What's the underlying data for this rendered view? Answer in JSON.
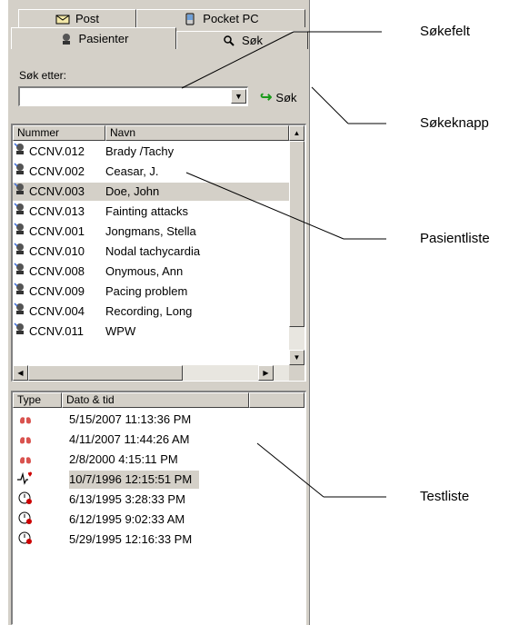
{
  "tabs": {
    "post": "Post",
    "pocket_pc": "Pocket PC",
    "pasienter": "Pasienter",
    "sok": "Søk"
  },
  "search": {
    "label": "Søk etter:",
    "value": "",
    "button_label": "Søk"
  },
  "patients": {
    "columns": [
      "Nummer",
      "Navn"
    ],
    "rows": [
      {
        "number": "CCNV.012",
        "name": "Brady /Tachy"
      },
      {
        "number": "CCNV.002",
        "name": "Ceasar, J."
      },
      {
        "number": "CCNV.003",
        "name": "Doe, John"
      },
      {
        "number": "CCNV.013",
        "name": "Fainting attacks"
      },
      {
        "number": "CCNV.001",
        "name": "Jongmans, Stella"
      },
      {
        "number": "CCNV.010",
        "name": "Nodal tachycardia"
      },
      {
        "number": "CCNV.008",
        "name": "Onymous, Ann"
      },
      {
        "number": "CCNV.009",
        "name": "Pacing problem"
      },
      {
        "number": "CCNV.004",
        "name": "Recording, Long"
      },
      {
        "number": "CCNV.011",
        "name": "WPW"
      }
    ],
    "selected_index": 2
  },
  "tests": {
    "columns": [
      "Type",
      "Dato & tid"
    ],
    "rows": [
      {
        "icon": "lungs-icon",
        "datetime": "5/15/2007 11:13:36 PM"
      },
      {
        "icon": "lungs-icon",
        "datetime": "4/11/2007 11:44:26 AM"
      },
      {
        "icon": "lungs-icon",
        "datetime": "2/8/2000 4:15:11 PM"
      },
      {
        "icon": "ecg-heart-icon",
        "datetime": "10/7/1996 12:15:51 PM"
      },
      {
        "icon": "stopwatch-icon",
        "datetime": "6/13/1995 3:28:33 PM"
      },
      {
        "icon": "stopwatch-icon",
        "datetime": "6/12/1995 9:02:33 AM"
      },
      {
        "icon": "stopwatch-icon",
        "datetime": "5/29/1995 12:16:33 PM"
      }
    ],
    "selected_index": 3
  },
  "callouts": {
    "sokefelt": "Søkefelt",
    "sokeknapp": "Søkeknapp",
    "pasientliste": "Pasientliste",
    "testliste": "Testliste"
  },
  "colors": {
    "window_bg": "#d4d0c8",
    "lung_red": "#d9534f",
    "ok_green": "#1a9a1a"
  }
}
